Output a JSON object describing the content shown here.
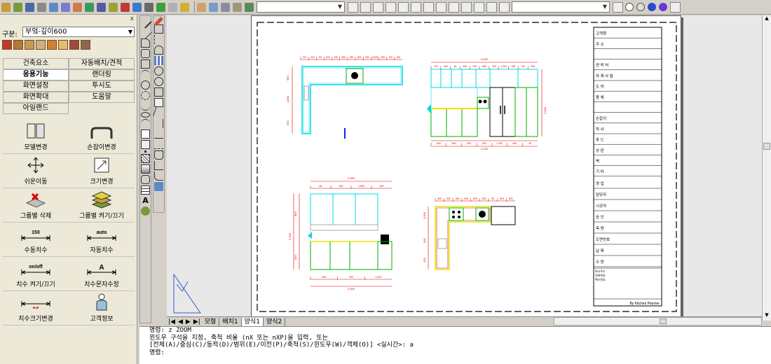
{
  "toolbar": {
    "combo1_value": "",
    "combo2_value": "",
    "combo3_value": ""
  },
  "left_panel": {
    "close_label": "x",
    "gubun_label": "구분:",
    "gubun_value": "부엌-깊이600",
    "menu": [
      [
        "건축요소",
        "자동배치/견적"
      ],
      [
        "응용기능",
        "랜더링"
      ],
      [
        "화면설정",
        "투시도"
      ],
      [
        "화면확대",
        "도움말"
      ],
      [
        "아일랜드",
        ""
      ]
    ],
    "tools": [
      [
        "모델변경",
        "손잡이변경"
      ],
      [
        "쉬운이동",
        "크기변경"
      ],
      [
        "그룹별 삭제",
        "그룹별 켜기/끄기"
      ],
      [
        "수동치수",
        "자동치수"
      ],
      [
        "치수 켜기/끄기",
        "치수문자수정"
      ],
      [
        "치수크기변경",
        "고객정보"
      ]
    ],
    "tool_texts": {
      "manual_dim": "150",
      "auto_dim": "auto",
      "onoff": "on/off",
      "text_a": "A"
    }
  },
  "tabs": [
    "모형",
    "배치1",
    "양식1",
    "양식2"
  ],
  "active_tab": "양식1",
  "command_lines": [
    "명령: z ZOOM",
    "윈도우 구석을 지정, 축척 비율 (nX 또는 nXP)을 입력, 또는",
    "[전체(A)/중심(C)/동적(D)/범위(E)/이전(P)/축척(S)/윈도우(W)/객체(O)] <실시간>: a",
    "명령:"
  ],
  "title_block": {
    "rows": [
      "고객명",
      "주 소",
      "",
      "연 락 처",
      "자 재 사 항",
      "도 어",
      "몸 체",
      "",
      "손잡이",
      "착 사",
      "후 드",
      "상 판",
      "벽",
      "기 타"
    ],
    "rows2": [
      "영 업",
      "담당자",
      "시공자",
      "승 인",
      "측 량",
      "도면번호",
      "날 짜",
      "수 량"
    ],
    "notes": [
      "회사주소",
      "전화번호",
      "팩스번호"
    ],
    "footer": "By Kitchen Planner"
  },
  "dimensions": {
    "plan1_top": [
      "370",
      "340",
      "60",
      "600",
      "230",
      "580",
      "250",
      "600",
      "250",
      "3,600",
      "250",
      "700",
      "250"
    ],
    "plan1_left": [
      "600",
      "1,800",
      "550"
    ],
    "elev1_top_total": "4,020",
    "elev1_top": [
      "370",
      "340",
      "60",
      "600",
      "230",
      "580",
      "250",
      "1,200",
      "250",
      "700",
      "250"
    ],
    "elev1_bottom": [
      "600",
      "600",
      "600",
      "900",
      "1,200",
      "662",
      "40"
    ],
    "elev1_bottom_total": "4,100",
    "elev1_right": "2,400",
    "plan2_top_total": "2,550",
    "plan2_top": [
      "60",
      "930",
      "1,800",
      "600"
    ],
    "plan2_left": [
      "800",
      "2,200",
      "820"
    ],
    "plan2_bottom": [
      "600",
      "900",
      "1,000"
    ],
    "plan2_bottom_total": "2,550",
    "elev2_top": [
      "600",
      "600",
      "600",
      "600",
      "600",
      "600",
      "50",
      "600",
      "600"
    ],
    "elev2_left": [
      "1,500",
      "900",
      "550",
      "600"
    ]
  },
  "colors": {
    "cyan": "#00d7e6",
    "green": "#00b000",
    "yellow": "#e6e600",
    "red": "#e00000",
    "blue": "#1a1aff"
  }
}
